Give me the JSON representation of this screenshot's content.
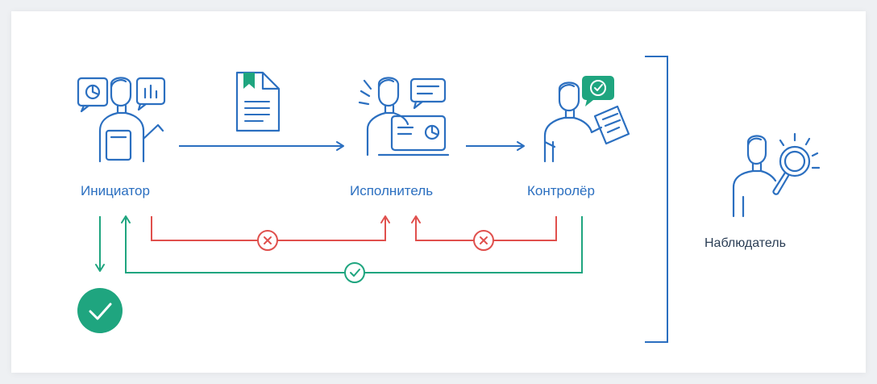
{
  "roles": {
    "initiator": {
      "label": "Инициатор",
      "icon": "initiator-person-icon"
    },
    "executor": {
      "label": "Исполнитель",
      "icon": "executor-person-icon"
    },
    "controller": {
      "label": "Контролёр",
      "icon": "controller-person-icon"
    },
    "observer": {
      "label": "Наблюдатель",
      "icon": "observer-person-icon"
    }
  },
  "colors": {
    "primary": "#2b6fc0",
    "reject": "#e0504d",
    "approve": "#1fa57f",
    "icon_outline": "#2b6fc0",
    "label_dark": "#2b3e55"
  },
  "icons": {
    "document": "document-icon",
    "reject": "reject-x-icon",
    "approve": "approve-check-icon",
    "done": "done-check-circle-icon",
    "approval_badge": "approval-badge-icon"
  }
}
